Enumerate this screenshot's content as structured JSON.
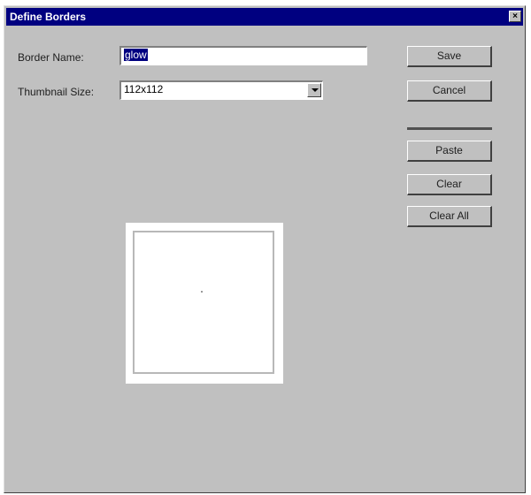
{
  "window": {
    "title": "Define Borders",
    "close_glyph": "×"
  },
  "form": {
    "border_name_label": "Border Name:",
    "border_name_value": "glow",
    "thumbnail_size_label": "Thumbnail Size:",
    "thumbnail_size_value": "112x112"
  },
  "buttons": {
    "save": "Save",
    "cancel": "Cancel",
    "paste": "Paste",
    "clear": "Clear",
    "clear_all": "Clear All"
  },
  "icons": {
    "close": "close-icon",
    "dropdown": "chevron-down-icon"
  }
}
